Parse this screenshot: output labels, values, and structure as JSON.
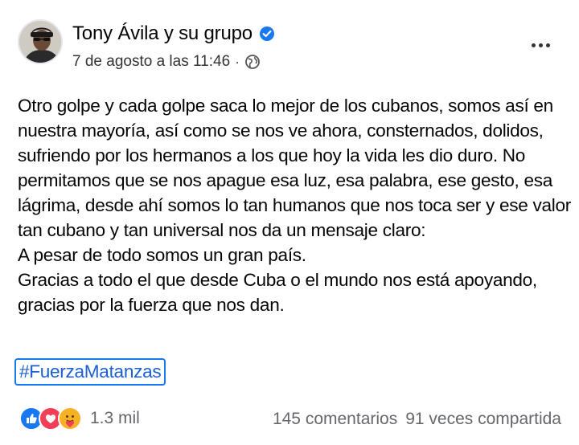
{
  "post": {
    "author": "Tony Ávila y su grupo",
    "timestamp": "7 de agosto a las 11:46",
    "separator": "·",
    "audience_icon": "globe-icon",
    "verified_icon": "verified-badge-icon",
    "more_icon": "more-options-icon",
    "body_lines": [
      "Otro golpe y cada golpe saca lo mejor de los cubanos, somos así en",
      "nuestra mayoría, así como se nos ve ahora, consternados, dolidos,",
      "sufriendo por los hermanos a los que hoy la vida les dio duro. No",
      "permitamos que se nos apague esa luz, esa palabra, ese gesto, esa",
      "lágrima, desde ahí somos lo tan humanos que nos toca ser y ese valor",
      "tan cubano y tan universal nos da un mensaje claro:",
      "A pesar de todo somos un gran país.",
      "Gracias a todo el que desde Cuba o el mundo nos está apoyando,",
      "gracias por la fuerza que nos dan."
    ],
    "hashtag": "#FuerzaMatanzas"
  },
  "footer": {
    "reaction_icons": [
      "like-icon",
      "love-icon",
      "care-icon"
    ],
    "reaction_count": "1.3 mil",
    "comments": "145 comentarios",
    "shares": "91 veces compartida"
  },
  "colors": {
    "accent": "#1877f2",
    "like": "#1877f2",
    "love": "#f33e58",
    "care": "#f7b125",
    "secondary_text": "#65676b"
  }
}
